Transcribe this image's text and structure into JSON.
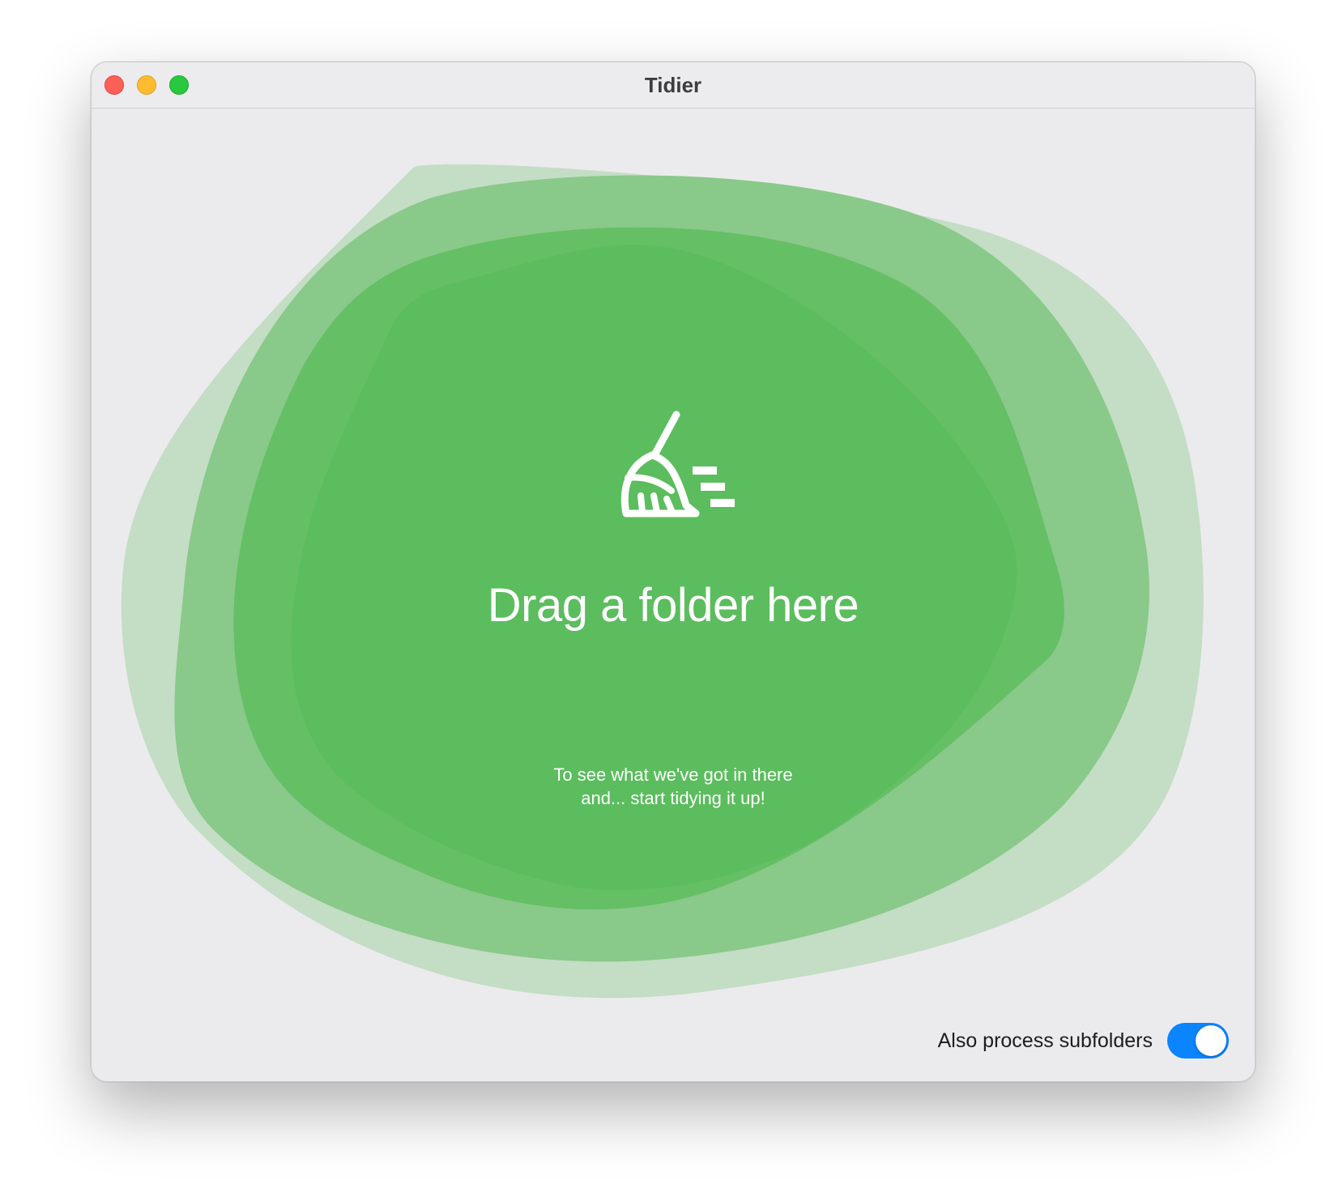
{
  "window": {
    "title": "Tidier",
    "traffic_lights": [
      "close",
      "minimize",
      "zoom"
    ]
  },
  "drop_zone": {
    "icon": "broom-icon",
    "headline": "Drag a folder here",
    "subtitle_lines": [
      "To see what we've got in there",
      "and... start tidying it up!"
    ]
  },
  "footer": {
    "subfolders_label": "Also process subfolders",
    "subfolders_enabled": true
  },
  "colors": {
    "blob_outer": "#c4ddc5",
    "blob_mid": "#89c989",
    "blob_inner": "#65bf65",
    "blob_core": "#5bbd5d",
    "toggle_on": "#0a84ff"
  }
}
